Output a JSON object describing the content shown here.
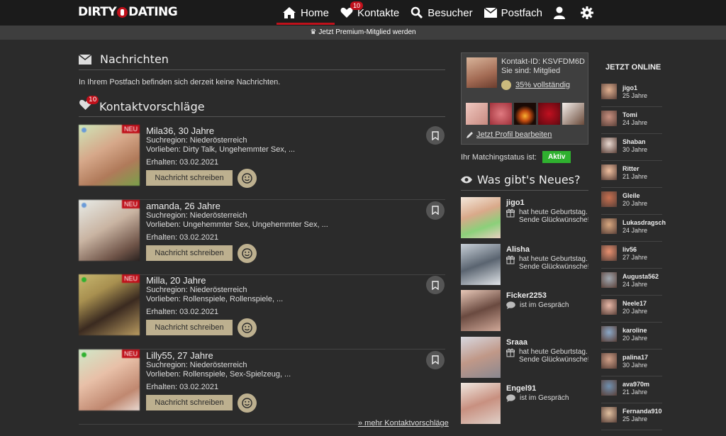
{
  "header": {
    "logo": {
      "left": "DIRTY",
      "right": "DATING"
    },
    "nav": [
      {
        "label": "Home",
        "icon": "home-icon"
      },
      {
        "label": "Kontakte",
        "icon": "heart-icon",
        "badge": "10"
      },
      {
        "label": "Besucher",
        "icon": "search-icon"
      },
      {
        "label": "Postfach",
        "icon": "mail-icon"
      },
      {
        "label": "",
        "icon": "user-icon"
      },
      {
        "label": "",
        "icon": "gear-icon"
      }
    ],
    "premium": "Jetzt Premium-Mitglied werden"
  },
  "messages": {
    "title": "Nachrichten",
    "empty": "In Ihrem Postfach befinden sich derzeit keine Nachrichten."
  },
  "suggestions": {
    "title": "Kontaktvorschläge",
    "badge": "10",
    "more": "» mehr Kontaktvorschläge",
    "items": [
      {
        "name": "Mila36, 30 Jahre",
        "region": "Suchregion: Niederösterreich",
        "likes": "Vorlieben: Dirty Talk, Ungehemmter Sex, ...",
        "received": "Erhalten: 03.02.2021",
        "button": "Nachricht schreiben",
        "new": "NEU",
        "status": "away"
      },
      {
        "name": "amanda, 26 Jahre",
        "region": "Suchregion: Niederösterreich",
        "likes": "Vorlieben: Ungehemmter Sex, Ungehemmter Sex, ...",
        "received": "Erhalten: 03.02.2021",
        "button": "Nachricht schreiben",
        "new": "NEU",
        "status": "away"
      },
      {
        "name": "Milla, 20 Jahre",
        "region": "Suchregion: Niederösterreich",
        "likes": "Vorlieben: Rollenspiele, Rollenspiele, ...",
        "received": "Erhalten: 03.02.2021",
        "button": "Nachricht schreiben",
        "new": "NEU",
        "status": "online"
      },
      {
        "name": "Lilly55, 27 Jahre",
        "region": "Suchregion: Niederösterreich",
        "likes": "Vorlieben: Rollenspiele, Sex-Spielzeug, ...",
        "received": "Erhalten: 03.02.2021",
        "button": "Nachricht schreiben",
        "new": "NEU",
        "status": "online"
      }
    ]
  },
  "profile": {
    "contact_id": "Kontakt-ID: KSVFDM6D",
    "membership": "Sie sind: Mitglied",
    "completion": "35% vollständig",
    "edit": "Jetzt Profil bearbeiten",
    "match_label": "Ihr Matchingstatus ist:",
    "match_status": "Aktiv"
  },
  "news": {
    "title": "Was gibt's Neues?",
    "items": [
      {
        "name": "jigo1",
        "line1": "hat heute Geburtstag.",
        "line2": "Sende Glückwünsche!",
        "icon": "gift-icon"
      },
      {
        "name": "Alisha",
        "line1": "hat heute Geburtstag.",
        "line2": "Sende Glückwünsche!",
        "icon": "gift-icon"
      },
      {
        "name": "Ficker2253",
        "line1": "ist im Gespräch",
        "line2": "",
        "icon": "chat-icon"
      },
      {
        "name": "Sraaa",
        "line1": "hat heute Geburtstag.",
        "line2": "Sende Glückwünsche!",
        "icon": "gift-icon"
      },
      {
        "name": "Engel91",
        "line1": "ist im Gespräch",
        "line2": "",
        "icon": "chat-icon"
      }
    ]
  },
  "online": {
    "title": "JETZT ONLINE",
    "items": [
      {
        "name": "jigo1",
        "age": "25 Jahre"
      },
      {
        "name": "Tomi",
        "age": "24 Jahre"
      },
      {
        "name": "Shaban",
        "age": "30 Jahre"
      },
      {
        "name": "Ritter",
        "age": "21 Jahre"
      },
      {
        "name": "Gleile",
        "age": "20 Jahre"
      },
      {
        "name": "Lukasdragsch",
        "age": "24 Jahre"
      },
      {
        "name": "liv56",
        "age": "27 Jahre"
      },
      {
        "name": "Augusta562",
        "age": "24 Jahre"
      },
      {
        "name": "Neele17",
        "age": "20 Jahre"
      },
      {
        "name": "karoline",
        "age": "20 Jahre"
      },
      {
        "name": "palina17",
        "age": "30 Jahre"
      },
      {
        "name": "ava970m",
        "age": "21 Jahre"
      },
      {
        "name": "Fernanda910",
        "age": "25 Jahre"
      }
    ]
  },
  "colors": {
    "accent": "#c0111b",
    "button": "#bdb08f",
    "online": "#2fb12f",
    "away": "#6a9bd8"
  }
}
